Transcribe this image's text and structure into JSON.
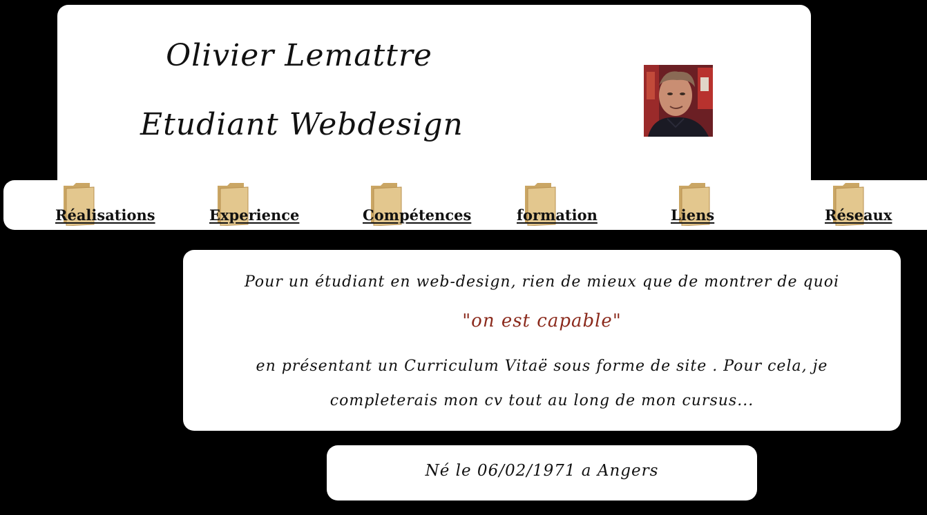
{
  "header": {
    "name": "Olivier Lemattre",
    "subtitle": "Etudiant Webdesign",
    "avatar_icon": "profile-photo"
  },
  "nav": {
    "items": [
      {
        "label": "Réalisations",
        "icon": "folder-icon"
      },
      {
        "label": "Experience",
        "icon": "folder-icon"
      },
      {
        "label": "Compétences",
        "icon": "folder-icon"
      },
      {
        "label": "formation",
        "icon": "folder-icon"
      },
      {
        "label": "Liens",
        "icon": "folder-icon"
      },
      {
        "label": "Réseaux",
        "icon": "folder-icon"
      }
    ]
  },
  "intro": {
    "line1": "Pour un étudiant en web-design, rien de mieux que de montrer de quoi",
    "highlight": "\"on est capable\"",
    "line3": "en présentant un Curriculum Vitaë sous forme de site . Pour cela, je completerais mon cv tout au long de mon cursus..."
  },
  "birth": {
    "text": "Né le 06/02/1971 a Angers"
  },
  "colors": {
    "background": "#000000",
    "card": "#ffffff",
    "highlight": "#8b2a1c",
    "folder": "#d9b878"
  }
}
